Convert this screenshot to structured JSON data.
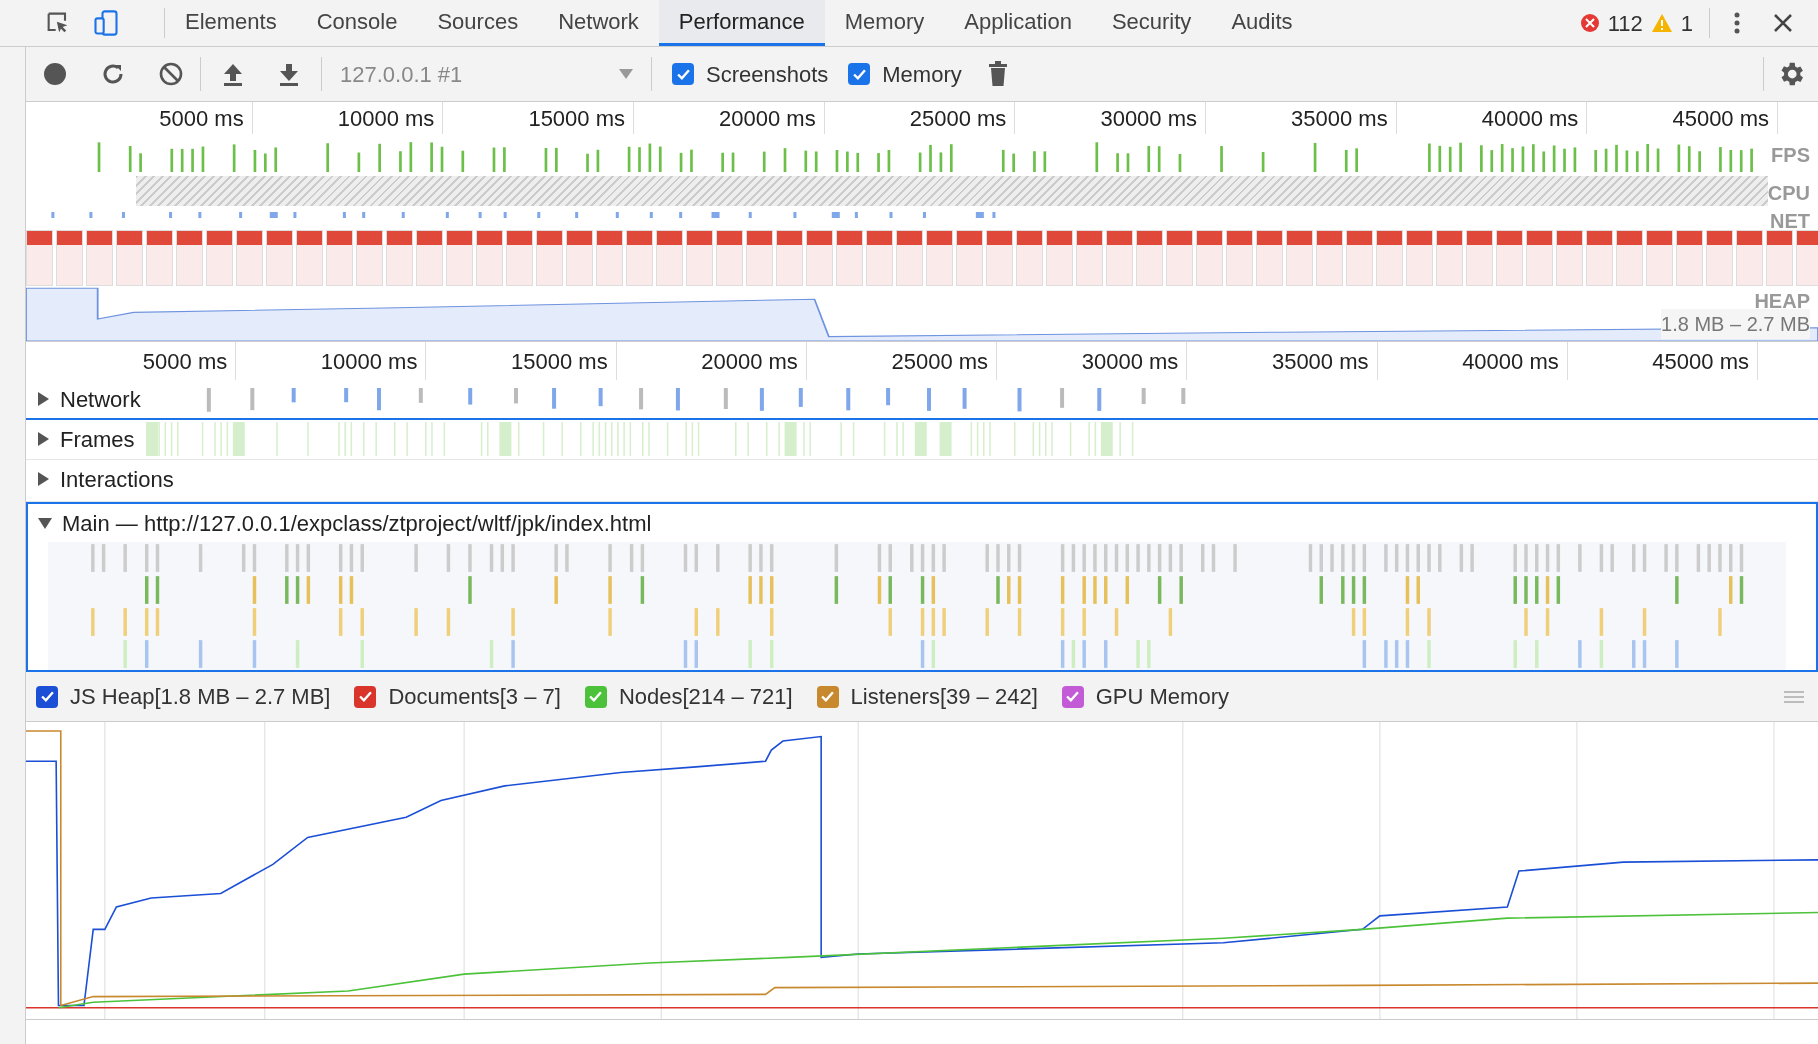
{
  "tab_bar": {
    "tabs": [
      {
        "label": "Elements",
        "selected": false
      },
      {
        "label": "Console",
        "selected": false
      },
      {
        "label": "Sources",
        "selected": false
      },
      {
        "label": "Network",
        "selected": false
      },
      {
        "label": "Performance",
        "selected": true
      },
      {
        "label": "Memory",
        "selected": false
      },
      {
        "label": "Application",
        "selected": false
      },
      {
        "label": "Security",
        "selected": false
      },
      {
        "label": "Audits",
        "selected": false
      }
    ],
    "errors": "112",
    "warnings": "1"
  },
  "toolbar": {
    "target": "127.0.0.1 #1",
    "checkboxes": [
      {
        "label": "Screenshots",
        "checked": true
      },
      {
        "label": "Memory",
        "checked": true
      }
    ]
  },
  "overview": {
    "ticks": [
      "5000 ms",
      "10000 ms",
      "15000 ms",
      "20000 ms",
      "25000 ms",
      "30000 ms",
      "35000 ms",
      "40000 ms",
      "45000 ms"
    ],
    "lanes": [
      "FPS",
      "CPU",
      "NET",
      "HEAP"
    ],
    "heap_range": "1.8 MB – 2.7 MB"
  },
  "timeline": {
    "ticks": [
      "5000 ms",
      "10000 ms",
      "15000 ms",
      "20000 ms",
      "25000 ms",
      "30000 ms",
      "35000 ms",
      "40000 ms",
      "45000 ms"
    ],
    "tracks": [
      {
        "kind": "network",
        "label": "Network",
        "expanded": false
      },
      {
        "kind": "frames",
        "label": "Frames",
        "expanded": false
      },
      {
        "kind": "interactions",
        "label": "Interactions",
        "expanded": false
      },
      {
        "kind": "main",
        "label": "Main — http://127.0.0.1/expclass/ztproject/wltf/jpk/index.html",
        "expanded": true
      }
    ]
  },
  "counters": [
    {
      "label": "JS Heap[1.8 MB – 2.7 MB]",
      "checked": true,
      "color": "#1a4fd6"
    },
    {
      "label": "Documents[3 – 7]",
      "checked": true,
      "color": "#d9352b"
    },
    {
      "label": "Nodes[214 – 721]",
      "checked": true,
      "color": "#4cc23a"
    },
    {
      "label": "Listeners[39 – 242]",
      "checked": true,
      "color": "#c8882e"
    },
    {
      "label": "GPU Memory",
      "checked": true,
      "color": "#c45bd6"
    }
  ]
}
